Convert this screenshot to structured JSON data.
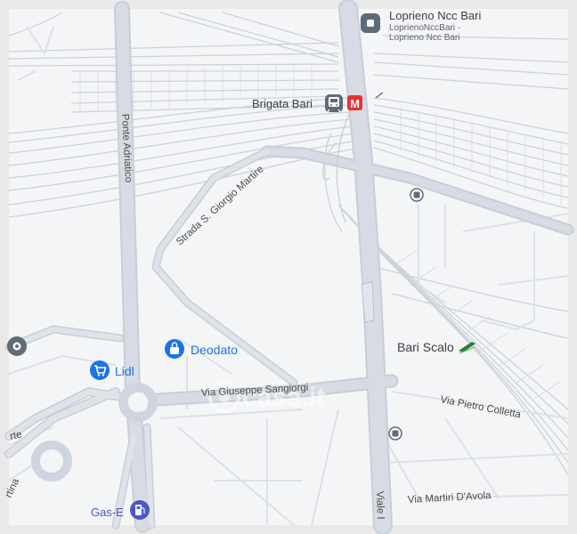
{
  "pois": {
    "loprieno": {
      "name": "Loprieno Ncc Bari",
      "sub1": "LoprienoNccBari -",
      "sub2": "Loprieno Ncc Bari",
      "icon": "place-pin-icon"
    },
    "brigata": {
      "name": "Brigata Bari",
      "icon": "train-station-icon",
      "metro_glyph": "M",
      "metro_color": "#e8312f"
    },
    "deodato": {
      "name": "Deodato",
      "icon": "shopping-bag-icon",
      "color": "#1a73e8"
    },
    "lidl": {
      "name": "Lidl",
      "icon": "shopping-cart-icon",
      "color": "#1a73e8"
    },
    "gas_e": {
      "name": "Gas-E",
      "icon": "fuel-pump-icon",
      "color": "#4c56c6"
    },
    "bari_scalo": {
      "name": "Bari Scalo",
      "icon": "train-icon",
      "color": "#2e7d32"
    },
    "unnamed_pin": {
      "icon": "place-pin-icon"
    }
  },
  "roads": {
    "ponte_adriatico": "Ponte Adriatico",
    "strada_san_giorgio": "Strada S. Giorgio Martire",
    "via_sangiorgi": "Via Giuseppe Sangiorgi",
    "via_colletta": "Via Pietro Colletta",
    "via_davola": "Via Martiri D'Avola",
    "viale": "Viale I",
    "edge_left_1": "rte",
    "edge_left_2": "rtina"
  },
  "watermark": "casa.it",
  "colors": {
    "land": "#f4f5f7",
    "road": "#d8dde6",
    "road_edge": "#c3cad4",
    "rail": "#cdd2d9",
    "frame": "#e6e6e6",
    "poi_gray": "#5f6b78"
  }
}
